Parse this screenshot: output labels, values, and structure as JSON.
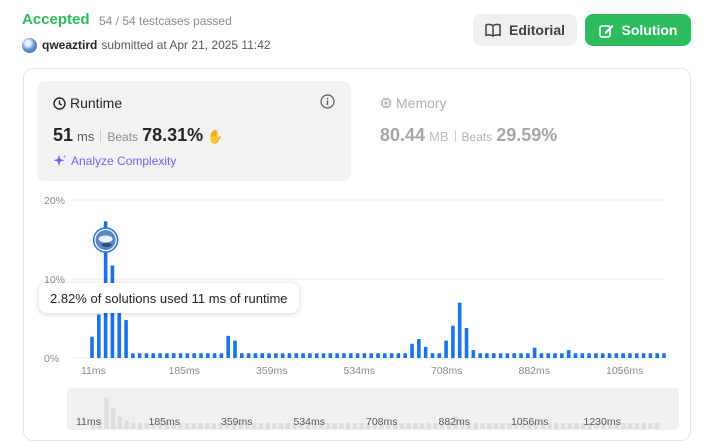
{
  "header": {
    "status": "Accepted",
    "testcases": "54 / 54 testcases passed",
    "username": "qweaztird",
    "submitted": "submitted at Apr 21, 2025 11:42",
    "editorial_label": "Editorial",
    "solution_label": "Solution"
  },
  "runtime": {
    "title": "Runtime",
    "value": "51",
    "unit": "ms",
    "beats_label": "Beats",
    "beats": "78.31%",
    "analyze_label": "Analyze Complexity"
  },
  "memory": {
    "title": "Memory",
    "value": "80.44",
    "unit": "MB",
    "beats_label": "Beats",
    "beats": "29.59%"
  },
  "tooltip": "2.82% of solutions used 11 ms of runtime",
  "colors": {
    "accent_green": "#2cbb5d",
    "bar_blue": "#1a73e8",
    "analyze_purple": "#7c5cf0"
  },
  "chart_data": {
    "type": "bar",
    "ylabel": "",
    "xlabel": "",
    "ylim": [
      0,
      20
    ],
    "y_ticks": [
      "20%",
      "10%",
      "0%"
    ],
    "x_tick_labels": [
      "11ms",
      "185ms",
      "359ms",
      "534ms",
      "708ms",
      "882ms",
      "1056ms",
      "1230ms"
    ],
    "values": [
      2.7,
      5.5,
      17.3,
      11.7,
      6.8,
      4.8,
      0.6,
      0.6,
      0.6,
      0.6,
      0.6,
      0.6,
      0.6,
      0.6,
      0.6,
      0.6,
      0.6,
      0.6,
      0.6,
      0.6,
      2.8,
      2.2,
      0.6,
      0.6,
      0.6,
      0.6,
      0.6,
      0.6,
      0.6,
      0.6,
      0.6,
      0.6,
      0.6,
      0.6,
      0.6,
      0.6,
      0.6,
      0.6,
      0.6,
      0.6,
      0.6,
      0.6,
      0.6,
      0.6,
      0.6,
      0.6,
      0.6,
      1.8,
      2.4,
      1.4,
      0.6,
      0.6,
      2.2,
      4.1,
      7.0,
      3.8,
      1.0,
      0.6,
      0.6,
      0.6,
      0.6,
      0.6,
      0.6,
      0.6,
      0.6,
      1.3,
      0.6,
      0.6,
      0.6,
      0.6,
      1.0,
      0.6,
      0.6,
      0.6,
      0.6,
      0.6,
      0.6,
      0.6,
      0.6,
      0.6,
      0.6,
      0.6,
      0.6,
      0.6,
      0.6
    ],
    "highlight_value": "11ms",
    "grid": true
  }
}
